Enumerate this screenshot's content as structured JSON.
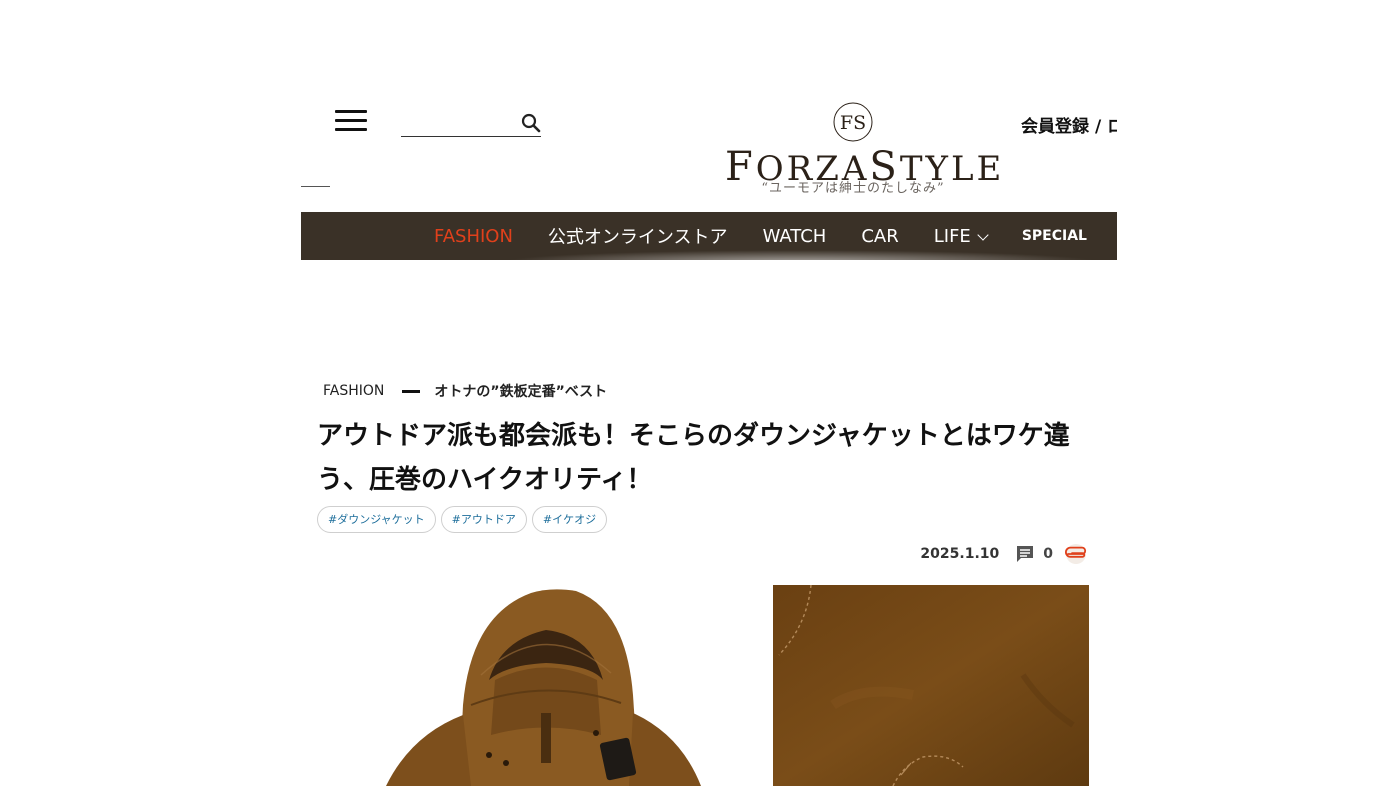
{
  "header": {
    "search_placeholder": "",
    "logo_monogram": "FS",
    "logo_brand_f": "F",
    "logo_brand_orza": "ORZA",
    "logo_brand_s": "S",
    "logo_brand_tyle": "TYLE",
    "logo_tagline": "“ユーモアは紳士のたしなみ”",
    "register": "会員登録",
    "separator": "/",
    "login": "ロ"
  },
  "nav": {
    "items": [
      {
        "label": "FASHION",
        "active": true
      },
      {
        "label": "公式オンラインストア"
      },
      {
        "label": "WATCH"
      },
      {
        "label": "CAR"
      },
      {
        "label": "LIFE"
      },
      {
        "label": "SPECIAL"
      }
    ]
  },
  "article": {
    "category": "FASHION",
    "subcategory": "オトナの”鉄板定番”ベスト",
    "title": "アウトドア派も都会派も！そこらのダウンジャケットとはワケ違う、圧巻のハイクオリティ！",
    "tags": [
      "#ダウンジャケット",
      "#アウトドア",
      "#イケオジ"
    ],
    "date": "2025.1.10",
    "comment_count": "0"
  },
  "colors": {
    "nav_bg": "#3a3127",
    "nav_active": "#e0401b",
    "tag_text": "#1d6e9b",
    "clip_accent": "#e0401b",
    "jacket": "#8a5a22"
  },
  "icons": [
    "hamburger-icon",
    "search-icon",
    "comment-icon",
    "paperclip-icon",
    "chevron-down-icon"
  ]
}
